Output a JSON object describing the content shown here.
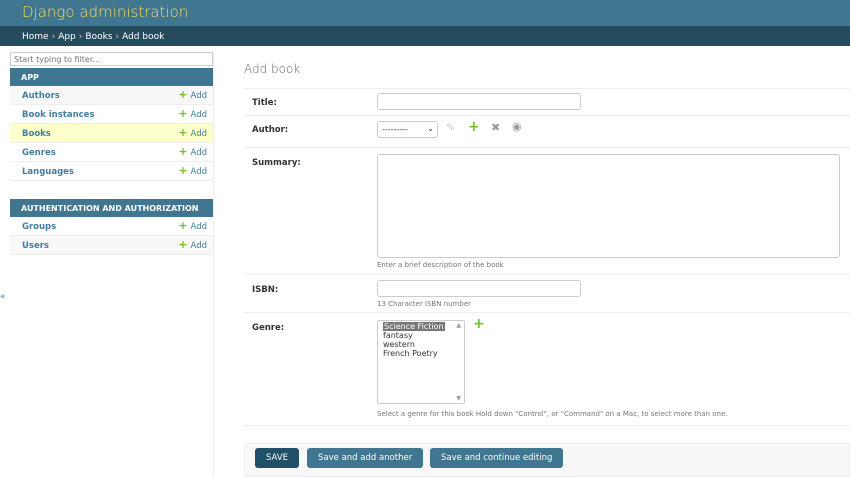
{
  "header": {
    "title": "Django administration"
  },
  "breadcrumbs": [
    "Home",
    "App",
    "Books",
    "Add book"
  ],
  "sidebar": {
    "filter_placeholder": "Start typing to filter...",
    "toggle": "«",
    "app": {
      "caption": "APP",
      "items": [
        {
          "label": "Authors",
          "add": "Add"
        },
        {
          "label": "Book instances",
          "add": "Add"
        },
        {
          "label": "Books",
          "add": "Add"
        },
        {
          "label": "Genres",
          "add": "Add"
        },
        {
          "label": "Languages",
          "add": "Add"
        }
      ]
    },
    "auth": {
      "caption": "AUTHENTICATION AND AUTHORIZATION",
      "items": [
        {
          "label": "Groups",
          "add": "Add"
        },
        {
          "label": "Users",
          "add": "Add"
        }
      ]
    }
  },
  "main": {
    "title": "Add book",
    "fields": {
      "title": {
        "label": "Title:",
        "value": ""
      },
      "author": {
        "label": "Author:",
        "selected": "---------"
      },
      "summary": {
        "label": "Summary:",
        "value": "",
        "help": "Enter a brief description of the book"
      },
      "isbn": {
        "label": "ISBN:",
        "value": "",
        "help": "13 Character ISBN number"
      },
      "genre": {
        "label": "Genre:",
        "options": [
          "Science Fiction",
          "fantasy",
          "western",
          "French Poetry"
        ],
        "selected": "Science Fiction",
        "help": "Select a genre for this book Hold down \"Control\", or \"Command\" on a Mac, to select more than one."
      }
    },
    "buttons": {
      "save": "SAVE",
      "save_add": "Save and add another",
      "save_continue": "Save and continue editing"
    }
  }
}
